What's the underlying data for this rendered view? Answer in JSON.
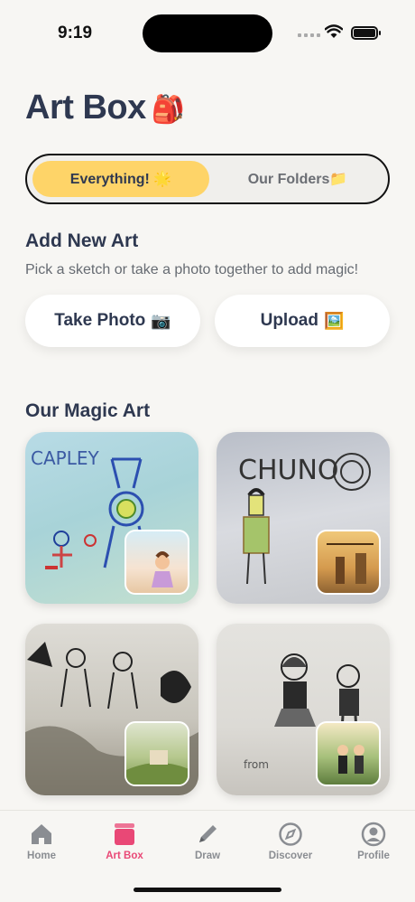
{
  "status_bar": {
    "time": "9:19"
  },
  "header": {
    "title": "Art Box",
    "title_emoji": "🎒"
  },
  "segmented": {
    "active_label": "Everything! 🌟",
    "inactive_label": "Our Folders📁"
  },
  "add_section": {
    "title": "Add New Art",
    "subtitle": "Pick a sketch or take a photo together to add magic!",
    "take_photo_label": "Take Photo",
    "take_photo_emoji": "📷",
    "upload_label": "Upload",
    "upload_emoji": "🖼️"
  },
  "gallery": {
    "title": "Our Magic Art",
    "items": [
      {
        "sketch_text": "CAPLEY"
      },
      {
        "sketch_text": "CHUNO"
      },
      {
        "sketch_text": ""
      },
      {
        "sketch_text": ""
      }
    ]
  },
  "tab_bar": {
    "active": "Art Box",
    "tabs": [
      {
        "label": "Home",
        "icon": "home-icon"
      },
      {
        "label": "Art Box",
        "icon": "artbox-icon"
      },
      {
        "label": "Draw",
        "icon": "pencil-icon"
      },
      {
        "label": "Discover",
        "icon": "compass-icon"
      },
      {
        "label": "Profile",
        "icon": "person-icon"
      }
    ]
  },
  "colors": {
    "accent_yellow": "#fed468",
    "accent_pink": "#e94876",
    "title_navy": "#2e3850",
    "background": "#f7f6f3"
  }
}
